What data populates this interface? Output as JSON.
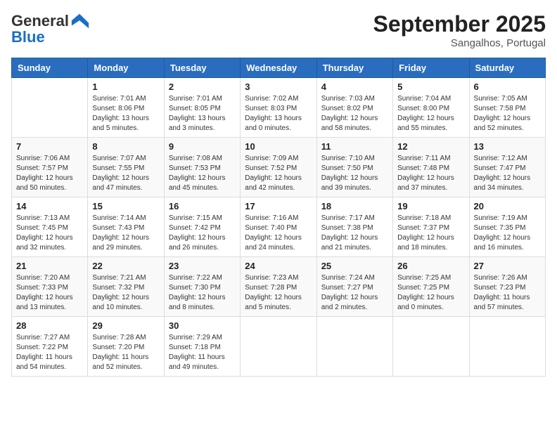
{
  "logo": {
    "general": "General",
    "blue": "Blue"
  },
  "header": {
    "month": "September 2025",
    "location": "Sangalhos, Portugal"
  },
  "weekdays": [
    "Sunday",
    "Monday",
    "Tuesday",
    "Wednesday",
    "Thursday",
    "Friday",
    "Saturday"
  ],
  "weeks": [
    [
      {
        "day": "",
        "sunrise": "",
        "sunset": "",
        "daylight": ""
      },
      {
        "day": "1",
        "sunrise": "Sunrise: 7:01 AM",
        "sunset": "Sunset: 8:06 PM",
        "daylight": "Daylight: 13 hours and 5 minutes."
      },
      {
        "day": "2",
        "sunrise": "Sunrise: 7:01 AM",
        "sunset": "Sunset: 8:05 PM",
        "daylight": "Daylight: 13 hours and 3 minutes."
      },
      {
        "day": "3",
        "sunrise": "Sunrise: 7:02 AM",
        "sunset": "Sunset: 8:03 PM",
        "daylight": "Daylight: 13 hours and 0 minutes."
      },
      {
        "day": "4",
        "sunrise": "Sunrise: 7:03 AM",
        "sunset": "Sunset: 8:02 PM",
        "daylight": "Daylight: 12 hours and 58 minutes."
      },
      {
        "day": "5",
        "sunrise": "Sunrise: 7:04 AM",
        "sunset": "Sunset: 8:00 PM",
        "daylight": "Daylight: 12 hours and 55 minutes."
      },
      {
        "day": "6",
        "sunrise": "Sunrise: 7:05 AM",
        "sunset": "Sunset: 7:58 PM",
        "daylight": "Daylight: 12 hours and 52 minutes."
      }
    ],
    [
      {
        "day": "7",
        "sunrise": "Sunrise: 7:06 AM",
        "sunset": "Sunset: 7:57 PM",
        "daylight": "Daylight: 12 hours and 50 minutes."
      },
      {
        "day": "8",
        "sunrise": "Sunrise: 7:07 AM",
        "sunset": "Sunset: 7:55 PM",
        "daylight": "Daylight: 12 hours and 47 minutes."
      },
      {
        "day": "9",
        "sunrise": "Sunrise: 7:08 AM",
        "sunset": "Sunset: 7:53 PM",
        "daylight": "Daylight: 12 hours and 45 minutes."
      },
      {
        "day": "10",
        "sunrise": "Sunrise: 7:09 AM",
        "sunset": "Sunset: 7:52 PM",
        "daylight": "Daylight: 12 hours and 42 minutes."
      },
      {
        "day": "11",
        "sunrise": "Sunrise: 7:10 AM",
        "sunset": "Sunset: 7:50 PM",
        "daylight": "Daylight: 12 hours and 39 minutes."
      },
      {
        "day": "12",
        "sunrise": "Sunrise: 7:11 AM",
        "sunset": "Sunset: 7:48 PM",
        "daylight": "Daylight: 12 hours and 37 minutes."
      },
      {
        "day": "13",
        "sunrise": "Sunrise: 7:12 AM",
        "sunset": "Sunset: 7:47 PM",
        "daylight": "Daylight: 12 hours and 34 minutes."
      }
    ],
    [
      {
        "day": "14",
        "sunrise": "Sunrise: 7:13 AM",
        "sunset": "Sunset: 7:45 PM",
        "daylight": "Daylight: 12 hours and 32 minutes."
      },
      {
        "day": "15",
        "sunrise": "Sunrise: 7:14 AM",
        "sunset": "Sunset: 7:43 PM",
        "daylight": "Daylight: 12 hours and 29 minutes."
      },
      {
        "day": "16",
        "sunrise": "Sunrise: 7:15 AM",
        "sunset": "Sunset: 7:42 PM",
        "daylight": "Daylight: 12 hours and 26 minutes."
      },
      {
        "day": "17",
        "sunrise": "Sunrise: 7:16 AM",
        "sunset": "Sunset: 7:40 PM",
        "daylight": "Daylight: 12 hours and 24 minutes."
      },
      {
        "day": "18",
        "sunrise": "Sunrise: 7:17 AM",
        "sunset": "Sunset: 7:38 PM",
        "daylight": "Daylight: 12 hours and 21 minutes."
      },
      {
        "day": "19",
        "sunrise": "Sunrise: 7:18 AM",
        "sunset": "Sunset: 7:37 PM",
        "daylight": "Daylight: 12 hours and 18 minutes."
      },
      {
        "day": "20",
        "sunrise": "Sunrise: 7:19 AM",
        "sunset": "Sunset: 7:35 PM",
        "daylight": "Daylight: 12 hours and 16 minutes."
      }
    ],
    [
      {
        "day": "21",
        "sunrise": "Sunrise: 7:20 AM",
        "sunset": "Sunset: 7:33 PM",
        "daylight": "Daylight: 12 hours and 13 minutes."
      },
      {
        "day": "22",
        "sunrise": "Sunrise: 7:21 AM",
        "sunset": "Sunset: 7:32 PM",
        "daylight": "Daylight: 12 hours and 10 minutes."
      },
      {
        "day": "23",
        "sunrise": "Sunrise: 7:22 AM",
        "sunset": "Sunset: 7:30 PM",
        "daylight": "Daylight: 12 hours and 8 minutes."
      },
      {
        "day": "24",
        "sunrise": "Sunrise: 7:23 AM",
        "sunset": "Sunset: 7:28 PM",
        "daylight": "Daylight: 12 hours and 5 minutes."
      },
      {
        "day": "25",
        "sunrise": "Sunrise: 7:24 AM",
        "sunset": "Sunset: 7:27 PM",
        "daylight": "Daylight: 12 hours and 2 minutes."
      },
      {
        "day": "26",
        "sunrise": "Sunrise: 7:25 AM",
        "sunset": "Sunset: 7:25 PM",
        "daylight": "Daylight: 12 hours and 0 minutes."
      },
      {
        "day": "27",
        "sunrise": "Sunrise: 7:26 AM",
        "sunset": "Sunset: 7:23 PM",
        "daylight": "Daylight: 11 hours and 57 minutes."
      }
    ],
    [
      {
        "day": "28",
        "sunrise": "Sunrise: 7:27 AM",
        "sunset": "Sunset: 7:22 PM",
        "daylight": "Daylight: 11 hours and 54 minutes."
      },
      {
        "day": "29",
        "sunrise": "Sunrise: 7:28 AM",
        "sunset": "Sunset: 7:20 PM",
        "daylight": "Daylight: 11 hours and 52 minutes."
      },
      {
        "day": "30",
        "sunrise": "Sunrise: 7:29 AM",
        "sunset": "Sunset: 7:18 PM",
        "daylight": "Daylight: 11 hours and 49 minutes."
      },
      {
        "day": "",
        "sunrise": "",
        "sunset": "",
        "daylight": ""
      },
      {
        "day": "",
        "sunrise": "",
        "sunset": "",
        "daylight": ""
      },
      {
        "day": "",
        "sunrise": "",
        "sunset": "",
        "daylight": ""
      },
      {
        "day": "",
        "sunrise": "",
        "sunset": "",
        "daylight": ""
      }
    ]
  ]
}
